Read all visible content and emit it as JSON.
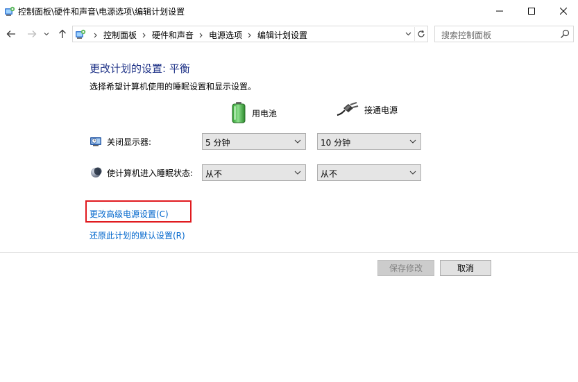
{
  "window": {
    "title": "控制面板\\硬件和声音\\电源选项\\编辑计划设置"
  },
  "address": {
    "crumbs": [
      "控制面板",
      "硬件和声音",
      "电源选项",
      "编辑计划设置"
    ]
  },
  "search": {
    "placeholder": "搜索控制面板"
  },
  "main": {
    "heading": "更改计划的设置: 平衡",
    "subtext": "选择希望计算机使用的睡眠设置和显示设置。",
    "columns": {
      "battery": "用电池",
      "plugged": "接通电源"
    },
    "rows": [
      {
        "label": "关闭显示器:",
        "battery_value": "5 分钟",
        "plugged_value": "10 分钟"
      },
      {
        "label": "使计算机进入睡眠状态:",
        "battery_value": "从不",
        "plugged_value": "从不"
      }
    ],
    "links": {
      "advanced": "更改高级电源设置(C)",
      "restore": "还原此计划的默认设置(R)"
    }
  },
  "buttons": {
    "save": "保存修改",
    "cancel": "取消"
  },
  "colors": {
    "heading": "#1e3287",
    "link": "#0066cc",
    "highlight": "#e0191e"
  }
}
